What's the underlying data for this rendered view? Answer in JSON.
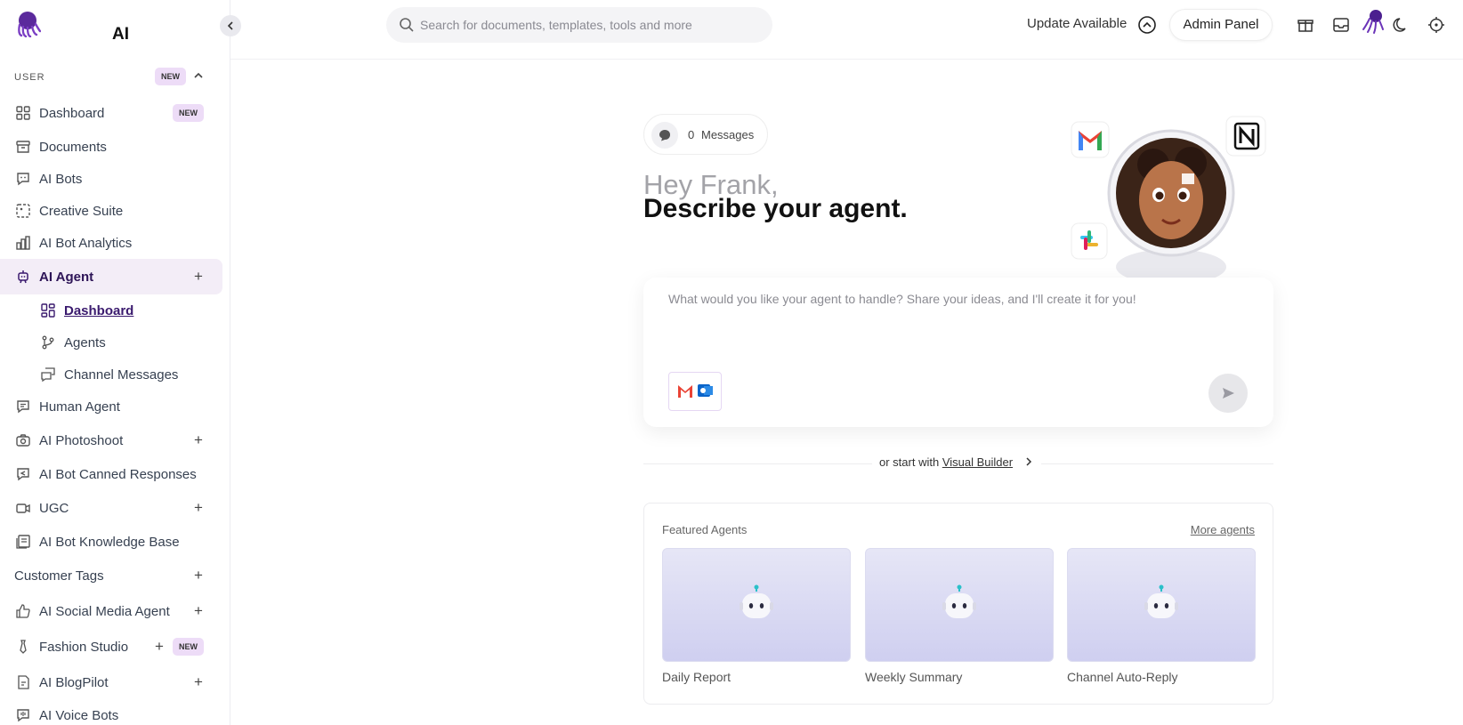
{
  "brand": {
    "name": "AI"
  },
  "sidebar": {
    "section_label": "USER",
    "section_badge": "NEW",
    "items": [
      {
        "label": "Dashboard",
        "badge": "NEW"
      },
      {
        "label": "Documents"
      },
      {
        "label": "AI Bots"
      },
      {
        "label": "Creative Suite"
      },
      {
        "label": "AI Bot Analytics"
      },
      {
        "label": "AI Agent",
        "plus": "+"
      },
      {
        "label": "Dashboard"
      },
      {
        "label": "Agents"
      },
      {
        "label": "Channel Messages"
      },
      {
        "label": "Human Agent"
      },
      {
        "label": "AI Photoshoot",
        "plus": "+"
      },
      {
        "label": "AI Bot Canned Responses"
      },
      {
        "label": "UGC",
        "plus": "+"
      },
      {
        "label": "AI Bot Knowledge Base"
      },
      {
        "label": "Customer Tags",
        "plus": "+"
      },
      {
        "label": "AI Social Media Agent",
        "plus": "+"
      },
      {
        "label": "Fashion Studio",
        "plus": "+",
        "badge": "NEW"
      },
      {
        "label": "AI BlogPilot",
        "plus": "+"
      },
      {
        "label": "AI Voice Bots"
      }
    ]
  },
  "topbar": {
    "search_placeholder": "Search for documents, templates, tools and more",
    "update_label": "Update Available",
    "admin_label": "Admin Panel"
  },
  "main": {
    "messages_count": "0",
    "messages_label": "Messages",
    "greeting": "Hey Frank,",
    "headline": "Describe your agent.",
    "prompt_placeholder": "What would you like your agent to handle? Share your ideas, and I'll create it for you!",
    "or_start_prefix": "or start with",
    "visual_builder": "Visual Builder",
    "featured_title": "Featured Agents",
    "more_agents": "More agents",
    "agents": [
      {
        "name": "Daily Report"
      },
      {
        "name": "Weekly Summary"
      },
      {
        "name": "Channel Auto-Reply"
      }
    ]
  },
  "colors": {
    "accent": "#3a1a6e",
    "active_bg": "#f3edf7",
    "badge_bg": "#eddcf7"
  },
  "icons": [
    "logo-icon",
    "search-icon",
    "chevron-up-circle-icon",
    "gift-icon",
    "inbox-icon",
    "moon-icon",
    "crosshair-icon",
    "chat-bubble-icon",
    "send-icon",
    "gmail-icon",
    "notion-icon",
    "slack-icon",
    "outlook-icon",
    "robot-icon"
  ]
}
